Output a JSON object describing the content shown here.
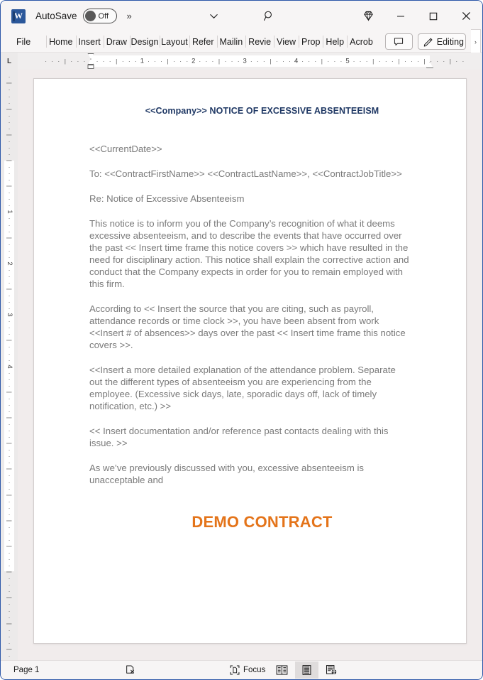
{
  "titlebar": {
    "app_icon": "word-icon",
    "autosave_label": "AutoSave",
    "autosave_state": "Off",
    "more_commands": "»",
    "customize_icon": "chevron-down-icon",
    "search_icon": "search-icon",
    "diamond_icon": "diamond-icon",
    "minimize": "─",
    "maximize": "☐",
    "close": "✕"
  },
  "ribbon": {
    "tabs": [
      {
        "label": "File",
        "name": "tab-file"
      },
      {
        "label": "Home",
        "name": "tab-home"
      },
      {
        "label": "Insert",
        "name": "tab-insert"
      },
      {
        "label": "Draw",
        "name": "tab-draw"
      },
      {
        "label": "Design",
        "name": "tab-design"
      },
      {
        "label": "Layout",
        "name": "tab-layout"
      },
      {
        "label": "Refer",
        "name": "tab-references"
      },
      {
        "label": "Mailin",
        "name": "tab-mailings"
      },
      {
        "label": "Revie",
        "name": "tab-review"
      },
      {
        "label": "View",
        "name": "tab-view"
      },
      {
        "label": "Prop",
        "name": "tab-proposify"
      },
      {
        "label": "Help",
        "name": "tab-help"
      },
      {
        "label": "Acrob",
        "name": "tab-acrobat"
      }
    ],
    "comment_icon": "comment-icon",
    "editing_label": "Editing",
    "editing_icon": "pencil-icon",
    "overflow_chevron": "›"
  },
  "ruler": {
    "tabstop_marker": "L",
    "numbers": [
      "1",
      "2",
      "3",
      "4",
      "5"
    ],
    "vertical_numbers": [
      "1",
      "2",
      "3",
      "4"
    ]
  },
  "document": {
    "title": "<<Company>> NOTICE OF EXCESSIVE ABSENTEEISM",
    "title_color": "#1f3864",
    "paragraphs": [
      "<<CurrentDate>>",
      "To: <<ContractFirstName>> <<ContractLastName>>, <<ContractJobTitle>>",
      "Re: Notice of Excessive Absenteeism",
      "This notice is to inform you of the Company’s recognition of what it deems excessive absenteeism, and to describe the events that have occurred over the past << Insert time frame this notice covers >> which have resulted in the need for disciplinary action. This notice shall explain the corrective action and conduct that the Company expects in order for you to remain employed with this firm.",
      "According to << Insert the source that you are citing, such as payroll, attendance records or time clock >>, you have been absent from work <<Insert # of absences>> days over the past << Insert time frame this notice covers >>.",
      "<<Insert a more detailed explanation of the attendance problem. Separate out the different types of absenteeism you are experiencing from the employee. (Excessive sick days, late, sporadic days off, lack of timely notification, etc.) >>",
      "<< Insert documentation and/or reference past contacts dealing with this issue. >>",
      "As we’ve previously discussed with you, excessive absenteeism is unacceptable and"
    ],
    "watermark": "DEMO CONTRACT",
    "watermark_color": "#E4741A",
    "body_color": "#7a7a7a"
  },
  "statusbar": {
    "page_label": "Page 1",
    "proofing_icon": "proofing-errors-icon",
    "focus_label": "Focus",
    "focus_icon": "focus-icon",
    "views": [
      {
        "name": "view-read-mode",
        "icon": "read-mode-icon",
        "active": false
      },
      {
        "name": "view-print-layout",
        "icon": "print-layout-icon",
        "active": true
      },
      {
        "name": "view-web-layout",
        "icon": "web-layout-icon",
        "active": false
      }
    ]
  }
}
